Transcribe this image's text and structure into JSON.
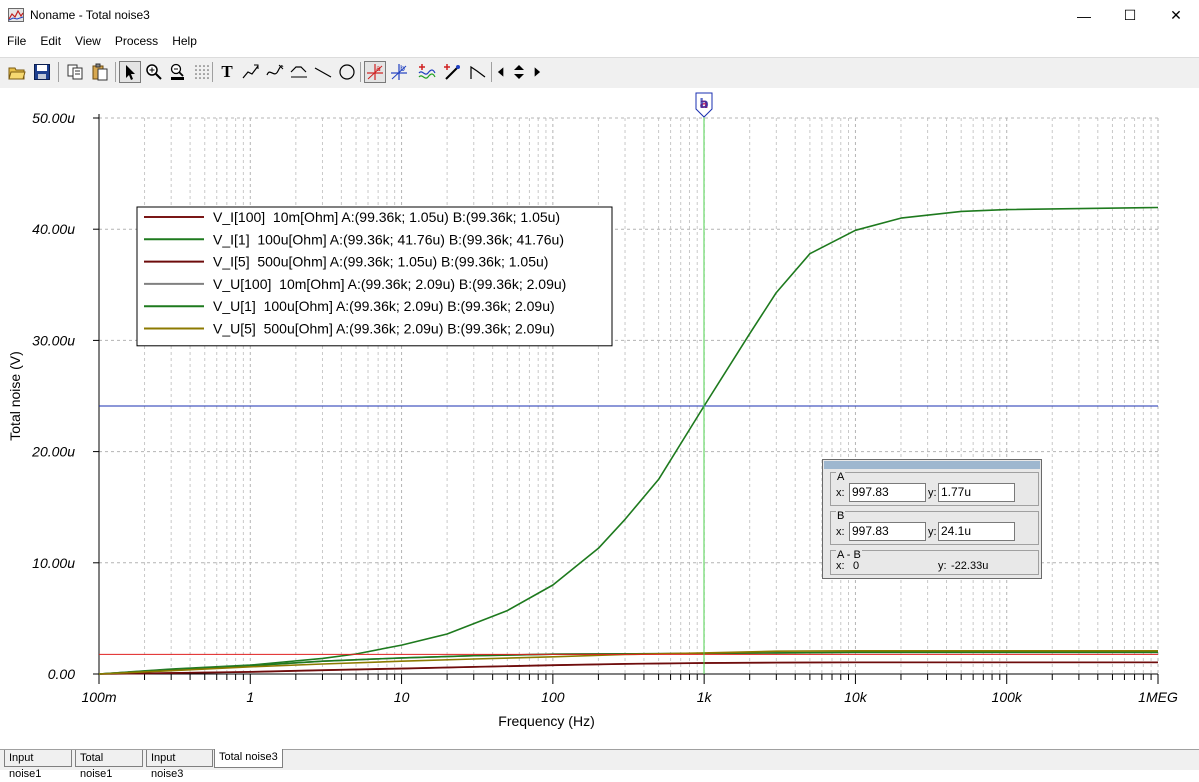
{
  "window": {
    "title": "Noname - Total noise3",
    "minimize": "—",
    "maximize": "☐",
    "close": "✕"
  },
  "menu": [
    "File",
    "Edit",
    "View",
    "Process",
    "Help"
  ],
  "toolbar": [
    {
      "name": "open-icon"
    },
    {
      "name": "save-icon"
    },
    {
      "name": "copy-icon"
    },
    {
      "name": "paste-icon"
    },
    {
      "name": "pointer-icon",
      "pressed": true
    },
    {
      "name": "zoom-in-icon"
    },
    {
      "name": "zoom-100-icon"
    },
    {
      "name": "grid-dots-icon"
    },
    {
      "name": "text-icon",
      "label": "T"
    },
    {
      "name": "draw-line-1-icon"
    },
    {
      "name": "draw-line-2-icon"
    },
    {
      "name": "draw-curve-icon"
    },
    {
      "name": "line-icon"
    },
    {
      "name": "circle-icon"
    },
    {
      "name": "cursor-a-icon",
      "label": "a",
      "pressed": true
    },
    {
      "name": "cursor-b-icon",
      "label": "b"
    },
    {
      "name": "add-curve-icon"
    },
    {
      "name": "probe-icon"
    },
    {
      "name": "step-icon"
    },
    {
      "name": "arrow-left-icon"
    },
    {
      "name": "arrow-updown-icon"
    },
    {
      "name": "arrow-right-icon"
    }
  ],
  "chart_data": {
    "type": "line",
    "x_scale": "log",
    "xlabel": "Frequency (Hz)",
    "ylabel": "Total noise (V)",
    "xlim": [
      0.1,
      1000000
    ],
    "ylim": [
      0,
      50
    ],
    "x_tick_values": [
      0.1,
      1,
      10,
      100,
      1000,
      10000,
      100000,
      1000000
    ],
    "x_tick_labels": [
      "100m",
      "1",
      "10",
      "100",
      "1k",
      "10k",
      "100k",
      "1MEG"
    ],
    "y_tick_values": [
      0,
      10,
      20,
      30,
      40,
      50
    ],
    "y_tick_labels": [
      "0.00",
      "10.00u",
      "20.00u",
      "30.00u",
      "40.00u",
      "50.00u"
    ],
    "grid": true,
    "legend_position": "top-left",
    "series": [
      {
        "name": "V_I[100]  10m[Ohm] A:(99.36k; 1.05u) B:(99.36k; 1.05u)",
        "color": "#7a1616",
        "x": [
          0.1,
          0.3,
          1,
          3,
          10,
          30,
          100,
          300,
          1000,
          3000,
          10000,
          100000,
          1000000
        ],
        "y": [
          0.0,
          0.1,
          0.2,
          0.35,
          0.5,
          0.65,
          0.8,
          0.92,
          1.0,
          1.03,
          1.05,
          1.05,
          1.05
        ]
      },
      {
        "name": "V_I[1]  100u[Ohm] A:(99.36k; 41.76u) B:(99.36k; 41.76u)",
        "color": "#1e7a1e",
        "x": [
          0.1,
          0.3,
          1,
          3,
          5,
          10,
          20,
          50,
          100,
          200,
          300,
          500,
          1000,
          2000,
          3000,
          5000,
          10000,
          20000,
          50000,
          100000,
          1000000
        ],
        "y": [
          0.0,
          0.45,
          0.8,
          1.4,
          1.8,
          2.6,
          3.6,
          5.7,
          8.0,
          11.3,
          13.9,
          17.5,
          24.1,
          30.6,
          34.3,
          37.8,
          39.9,
          41.0,
          41.6,
          41.76,
          41.95
        ]
      },
      {
        "name": "V_I[5]  500u[Ohm] A:(99.36k; 1.05u) B:(99.36k; 1.05u)",
        "color": "#6e0c0c",
        "x": [
          0.1,
          0.3,
          1,
          3,
          10,
          30,
          100,
          300,
          1000,
          3000,
          10000,
          100000,
          1000000
        ],
        "y": [
          0.0,
          0.08,
          0.18,
          0.33,
          0.48,
          0.63,
          0.78,
          0.9,
          0.98,
          1.02,
          1.05,
          1.05,
          1.05
        ]
      },
      {
        "name": "V_U[100]  10m[Ohm] A:(99.36k; 2.09u) B:(99.36k; 2.09u)",
        "color": "#808080",
        "x": [
          0.1,
          0.3,
          1,
          3,
          10,
          30,
          100,
          300,
          1000,
          3000,
          10000,
          100000,
          1000000
        ],
        "y": [
          0.0,
          0.4,
          0.75,
          1.15,
          1.45,
          1.65,
          1.78,
          1.82,
          1.85,
          1.9,
          1.95,
          1.95,
          1.95
        ]
      },
      {
        "name": "V_U[1]  100u[Ohm] A:(99.36k; 2.09u) B:(99.36k; 2.09u)",
        "color": "#1e7a1e",
        "x": [
          0.1,
          0.3,
          1,
          3,
          10,
          30,
          100,
          300,
          1000,
          3000,
          10000,
          100000,
          1000000
        ],
        "y": [
          0.0,
          0.4,
          0.75,
          1.15,
          1.45,
          1.65,
          1.78,
          1.82,
          1.85,
          1.9,
          1.95,
          1.95,
          1.95
        ]
      },
      {
        "name": "V_U[5]  500u[Ohm] A:(99.36k; 2.09u) B:(99.36k; 2.09u)",
        "color": "#8c7a00",
        "x": [
          0.1,
          0.3,
          1,
          3,
          10,
          30,
          100,
          300,
          1000,
          3000,
          10000,
          100000,
          1000000
        ],
        "y": [
          0.0,
          0.3,
          0.65,
          0.9,
          1.15,
          1.35,
          1.55,
          1.75,
          1.9,
          2.05,
          2.09,
          2.09,
          2.09
        ]
      }
    ],
    "cursor_a": {
      "x": 997.83,
      "y": 1.77,
      "color": "#e02020"
    },
    "cursor_b": {
      "x": 997.83,
      "y": 24.1,
      "color": "#1a2fb0",
      "label": "b"
    },
    "cursor_marker_text": "a"
  },
  "cursor_panel": {
    "a_label": "A",
    "a_x_label": "x:",
    "a_x": "997.83",
    "a_y_label": "y:",
    "a_y": "1.77u",
    "b_label": "B",
    "b_x_label": "x:",
    "b_x": "997.83",
    "b_y_label": "y:",
    "b_y": "24.1u",
    "diff_label": "A - B",
    "diff_x_label": "x:",
    "diff_x": "0",
    "diff_y_label": "y:",
    "diff_y": "-22.33u"
  },
  "tabs": [
    {
      "label": "Input noise1",
      "active": false
    },
    {
      "label": "Total noise1",
      "active": false
    },
    {
      "label": "Input noise3",
      "active": false
    },
    {
      "label": "Total noise3",
      "active": true
    }
  ]
}
